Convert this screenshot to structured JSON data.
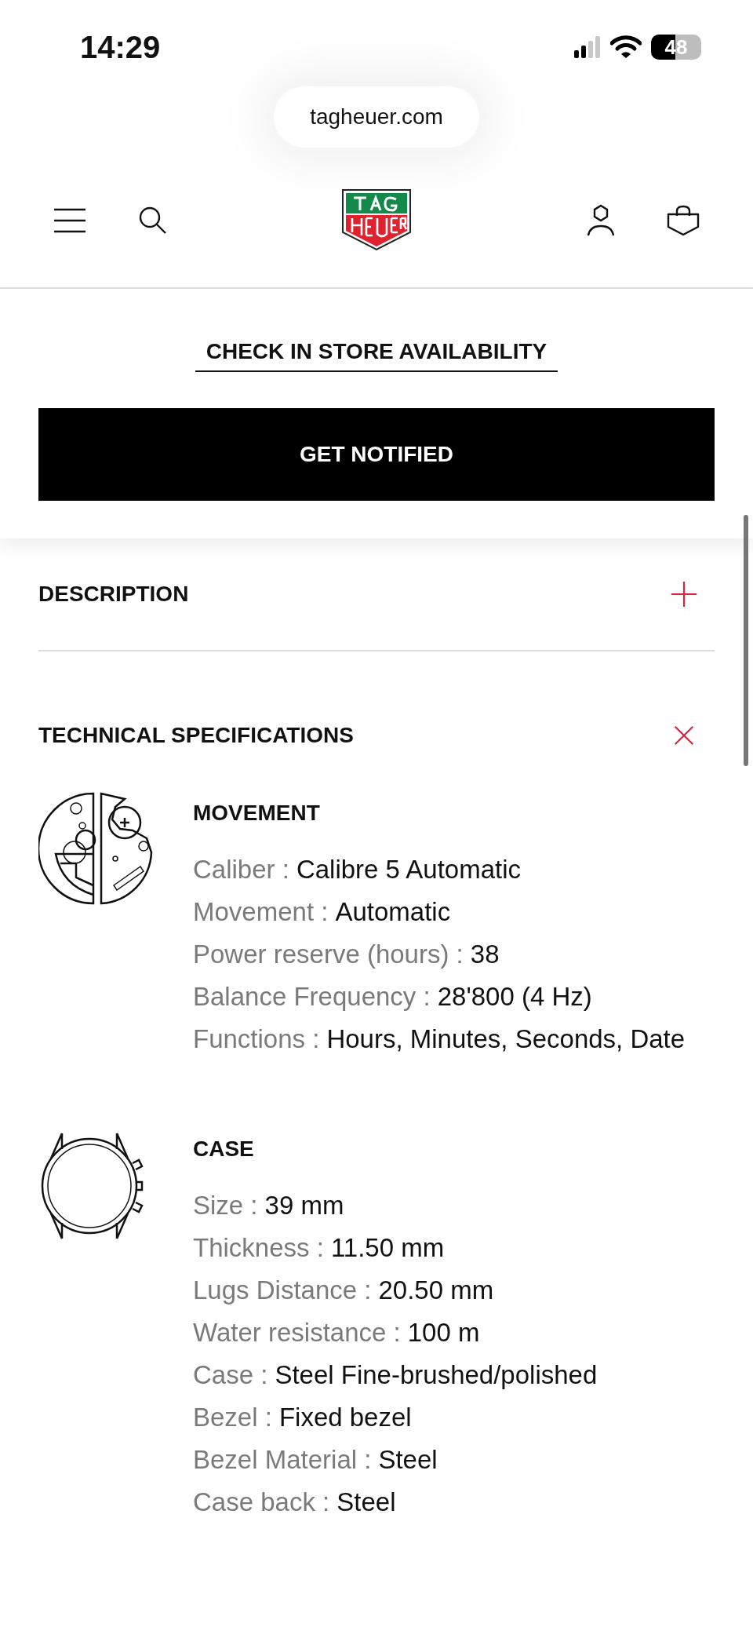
{
  "status_bar": {
    "time": "14:29",
    "battery": "48"
  },
  "address_bar": {
    "url": "tagheuer.com"
  },
  "store_link": "CHECK IN STORE AVAILABILITY",
  "primary_button": "GET NOTIFIED",
  "sections": [
    {
      "title": "DESCRIPTION",
      "expanded": false
    },
    {
      "title": "TECHNICAL SPECIFICATIONS",
      "expanded": true
    }
  ],
  "spec_groups": [
    {
      "kind": "movement",
      "title": "MOVEMENT",
      "items": [
        {
          "label": "Caliber :",
          "value": "Calibre 5 Automatic"
        },
        {
          "label": "Movement :",
          "value": "Automatic"
        },
        {
          "label": "Power reserve (hours) :",
          "value": "38"
        },
        {
          "label": "Balance Frequency :",
          "value": "28'800 (4 Hz)"
        },
        {
          "label": "Functions :",
          "value": "Hours, Minutes, Seconds, Date"
        }
      ]
    },
    {
      "kind": "case",
      "title": "CASE",
      "items": [
        {
          "label": "Size :",
          "value": "39 mm"
        },
        {
          "label": "Thickness :",
          "value": "11.50 mm"
        },
        {
          "label": "Lugs Distance :",
          "value": "20.50 mm"
        },
        {
          "label": "Water resistance :",
          "value": "100 m"
        },
        {
          "label": "Case :",
          "value": "Steel Fine-brushed/polished"
        },
        {
          "label": "Bezel :",
          "value": "Fixed bezel"
        },
        {
          "label": "Bezel Material :",
          "value": "Steel"
        },
        {
          "label": "Case back :",
          "value": "Steel"
        }
      ]
    }
  ]
}
